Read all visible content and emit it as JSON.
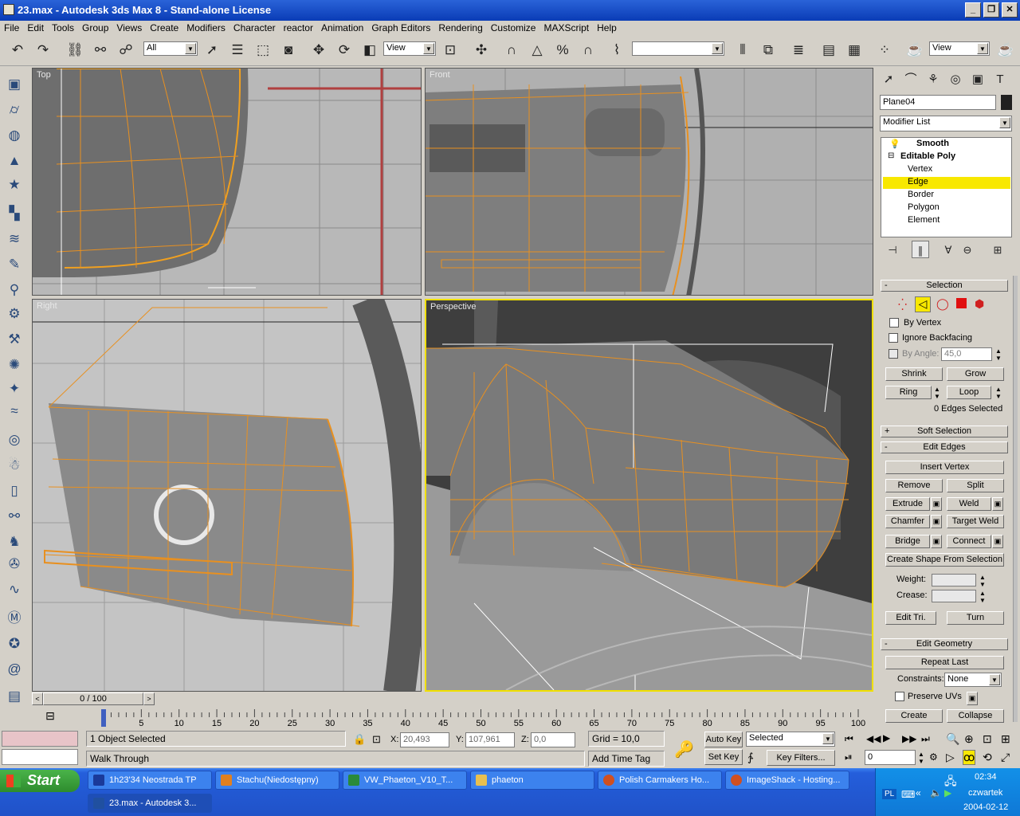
{
  "window": {
    "title": "23.max - Autodesk 3ds Max 8  - Stand-alone License"
  },
  "menu": [
    "File",
    "Edit",
    "Tools",
    "Group",
    "Views",
    "Create",
    "Modifiers",
    "Character",
    "reactor",
    "Animation",
    "Graph Editors",
    "Rendering",
    "Customize",
    "MAXScript",
    "Help"
  ],
  "toolbar": {
    "selection_filter": "All",
    "ref_coord": "View",
    "named_selection": "",
    "render_view": "View"
  },
  "viewports": {
    "top_left": "Top",
    "top_right": "Front",
    "bottom_left": "Right",
    "bottom_right": "Perspective"
  },
  "command_panel": {
    "object_name": "Plane04",
    "modifier_list": "Modifier List",
    "stack": [
      {
        "label": "Smooth"
      },
      {
        "label": "Editable Poly"
      },
      {
        "label": "Vertex"
      },
      {
        "label": "Edge"
      },
      {
        "label": "Border"
      },
      {
        "label": "Polygon"
      },
      {
        "label": "Element"
      }
    ],
    "selection": {
      "title": "Selection",
      "by_vertex": "By Vertex",
      "ignore_backfacing": "Ignore Backfacing",
      "by_angle": "By Angle:",
      "angle_value": "45,0",
      "shrink": "Shrink",
      "grow": "Grow",
      "ring": "Ring",
      "loop": "Loop",
      "status": "0 Edges Selected"
    },
    "soft_selection": "Soft Selection",
    "edit_edges": {
      "title": "Edit Edges",
      "insert_vertex": "Insert Vertex",
      "remove": "Remove",
      "split": "Split",
      "extrude": "Extrude",
      "weld": "Weld",
      "chamfer": "Chamfer",
      "target_weld": "Target Weld",
      "bridge": "Bridge",
      "connect": "Connect",
      "create_shape": "Create Shape From Selection",
      "weight": "Weight:",
      "crease": "Crease:",
      "edit_tri": "Edit Tri.",
      "turn": "Turn"
    },
    "edit_geometry": {
      "title": "Edit Geometry",
      "repeat_last": "Repeat Last",
      "constraints": "Constraints:",
      "constraints_value": "None",
      "preserve_uvs": "Preserve UVs",
      "create": "Create",
      "collapse": "Collapse"
    }
  },
  "timeline": {
    "frame": "0 / 100",
    "ticks": [
      "0",
      "5",
      "10",
      "15",
      "20",
      "25",
      "30",
      "35",
      "40",
      "45",
      "50",
      "55",
      "60",
      "65",
      "70",
      "75",
      "80",
      "85",
      "90",
      "95",
      "100"
    ]
  },
  "status": {
    "selection": "1 Object Selected",
    "prompt": "Walk Through",
    "x_label": "X:",
    "x": "20,493",
    "y_label": "Y:",
    "y": "107,961",
    "z_label": "Z:",
    "z": "0,0",
    "grid": "Grid = 10,0",
    "add_time_tag": "Add Time Tag",
    "auto_key": "Auto Key",
    "set_key": "Set Key",
    "key_mode": "Selected",
    "key_filters": "Key Filters...",
    "frame_field": "0"
  },
  "taskbar": {
    "start": "Start",
    "tasks": [
      {
        "label": "1h23'34 Neostrada TP",
        "color": "#1a3a9a"
      },
      {
        "label": "Stachu(Niedostępny)",
        "color": "#e08020"
      },
      {
        "label": "VW_Phaeton_V10_T...",
        "color": "#2a8a3a"
      },
      {
        "label": "phaeton",
        "color": "#e8c050"
      },
      {
        "label": "Polish Carmakers Ho...",
        "color": "#d05020"
      },
      {
        "label": "ImageShack - Hosting...",
        "color": "#d05020"
      },
      {
        "label": "23.max - Autodesk 3...",
        "color": "#2050a0"
      }
    ],
    "lang": "PL",
    "time": "02:34",
    "day": "czwartek",
    "date": "2004-02-12"
  }
}
